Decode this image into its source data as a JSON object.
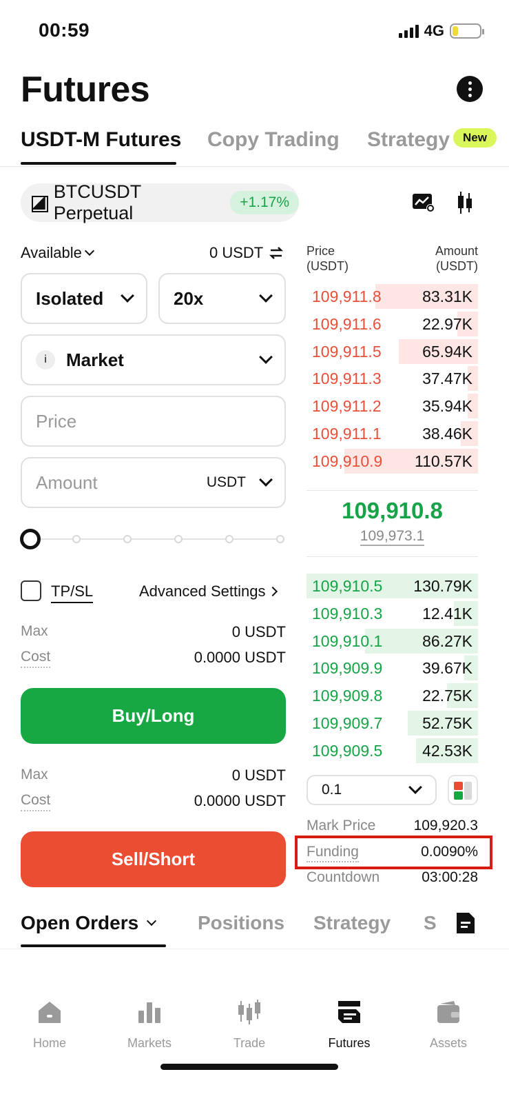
{
  "status_bar": {
    "time": "00:59",
    "network": "4G",
    "battery_level": 0.2
  },
  "header": {
    "title": "Futures"
  },
  "top_tabs": {
    "items": [
      {
        "label": "USDT-M Futures",
        "active": true
      },
      {
        "label": "Copy Trading",
        "active": false
      },
      {
        "label": "Strategy",
        "active": false
      }
    ],
    "new_badge": "New"
  },
  "pair": {
    "name": "BTCUSDT Perpetual",
    "change": "+1.17%"
  },
  "order_form": {
    "available_label": "Available",
    "available_value": "0 USDT",
    "margin_mode": "Isolated",
    "leverage": "20x",
    "order_type": "Market",
    "order_type_info": "i",
    "price_placeholder": "Price",
    "amount_placeholder": "Amount",
    "amount_unit": "USDT",
    "slider_value": 0,
    "tpsl_label": "TP/SL",
    "advanced_settings_label": "Advanced Settings",
    "buy": {
      "max_label": "Max",
      "max_value": "0 USDT",
      "cost_label": "Cost",
      "cost_value": "0.0000 USDT",
      "button_label": "Buy/Long"
    },
    "sell": {
      "max_label": "Max",
      "max_value": "0 USDT",
      "cost_label": "Cost",
      "cost_value": "0.0000 USDT",
      "button_label": "Sell/Short"
    }
  },
  "order_book": {
    "price_header": "Price\n(USDT)",
    "amount_header": "Amount\n(USDT)",
    "asks": [
      {
        "price": "109,911.8",
        "amount": "83.31K",
        "depth": 0.6
      },
      {
        "price": "109,911.6",
        "amount": "22.97K",
        "depth": 0.12
      },
      {
        "price": "109,911.5",
        "amount": "65.94K",
        "depth": 0.46
      },
      {
        "price": "109,911.3",
        "amount": "37.47K",
        "depth": 0.06
      },
      {
        "price": "109,911.2",
        "amount": "35.94K",
        "depth": 0.06
      },
      {
        "price": "109,911.1",
        "amount": "38.46K",
        "depth": 0.1
      },
      {
        "price": "109,910.9",
        "amount": "110.57K",
        "depth": 0.78
      }
    ],
    "last_price": "109,910.8",
    "index_price": "109,973.1",
    "bids": [
      {
        "price": "109,910.5",
        "amount": "130.79K",
        "depth": 1.0
      },
      {
        "price": "109,910.3",
        "amount": "12.41K",
        "depth": 0.14
      },
      {
        "price": "109,910.1",
        "amount": "86.27K",
        "depth": 0.66
      },
      {
        "price": "109,909.9",
        "amount": "39.67K",
        "depth": 0.08
      },
      {
        "price": "109,909.8",
        "amount": "22.75K",
        "depth": 0.18
      },
      {
        "price": "109,909.7",
        "amount": "52.75K",
        "depth": 0.41
      },
      {
        "price": "109,909.5",
        "amount": "42.53K",
        "depth": 0.36
      }
    ],
    "depth_step": "0.1"
  },
  "market_info": {
    "mark_price_label": "Mark Price",
    "mark_price_value": "109,920.3",
    "funding_label": "Funding",
    "funding_value": "0.0090%",
    "countdown_label": "Countdown",
    "countdown_value": "03:00:28"
  },
  "bottom_tabs": {
    "items": [
      {
        "label": "Open Orders",
        "active": true
      },
      {
        "label": "Positions",
        "active": false
      },
      {
        "label": "Strategy",
        "active": false
      },
      {
        "label": "S",
        "active": false
      }
    ]
  },
  "bottom_nav": {
    "items": [
      {
        "label": "Home",
        "icon": "home-icon",
        "active": false
      },
      {
        "label": "Markets",
        "icon": "bar-chart-icon",
        "active": false
      },
      {
        "label": "Trade",
        "icon": "candlestick-icon",
        "active": false
      },
      {
        "label": "Futures",
        "icon": "futures-icon",
        "active": true
      },
      {
        "label": "Assets",
        "icon": "wallet-icon",
        "active": false
      }
    ]
  },
  "colors": {
    "buy_green": "#17a843",
    "sell_red": "#ea4d31",
    "highlight_red": "#d91c10",
    "new_badge": "#d9f75a"
  }
}
